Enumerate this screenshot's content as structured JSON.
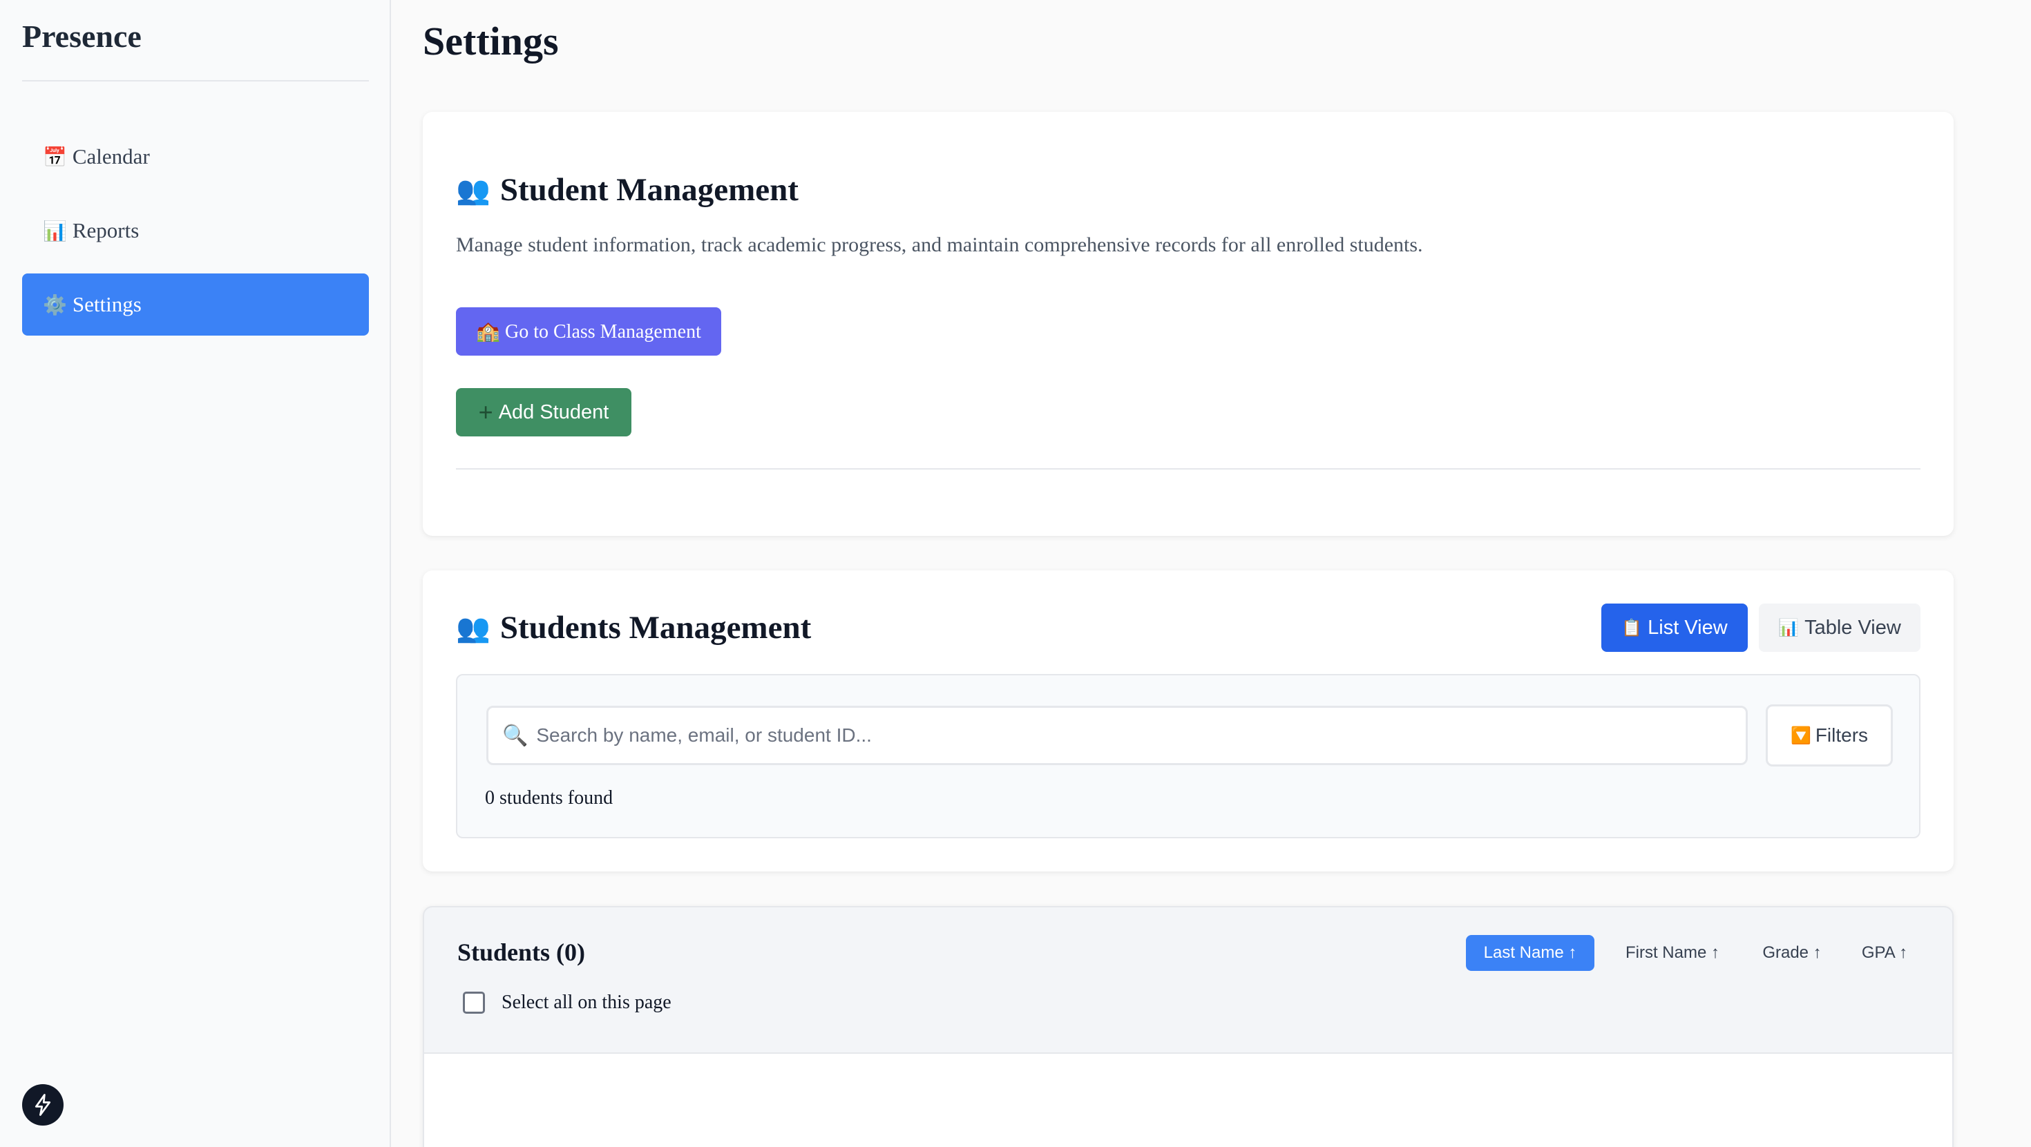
{
  "sidebar": {
    "brand": "Presence",
    "items": [
      {
        "icon": "📅",
        "icon_name": "calendar-icon",
        "label": "Calendar",
        "active": false
      },
      {
        "icon": "📊",
        "icon_name": "bar-chart-icon",
        "label": "Reports",
        "active": false
      },
      {
        "icon": "⚙️",
        "icon_name": "gear-icon",
        "label": "Settings",
        "active": true
      }
    ]
  },
  "page": {
    "title": "Settings"
  },
  "student_management": {
    "icon": "👥",
    "title": "Student Management",
    "description": "Manage student information, track academic progress, and maintain comprehensive records for all enrolled students.",
    "class_button": "🏫 Go to Class Management",
    "add_button_icon": "+",
    "add_button": "Add Student"
  },
  "students_management": {
    "icon": "👥",
    "title": "Students Management",
    "list_view": {
      "icon": "📋",
      "label": "List View",
      "active": true
    },
    "table_view": {
      "icon": "📊",
      "label": "Table View",
      "active": false
    },
    "search": {
      "icon": "🔍",
      "placeholder": "Search by name, email, or student ID...",
      "value": ""
    },
    "filters": {
      "icon": "🔽",
      "label": "Filters"
    },
    "count_text": "0 students found"
  },
  "students_list": {
    "title": "Students (0)",
    "sort_options": [
      {
        "label": "Last Name ↑",
        "active": true
      },
      {
        "label": "First Name ↑",
        "active": false
      },
      {
        "label": "Grade ↑",
        "active": false
      },
      {
        "label": "GPA ↑",
        "active": false
      }
    ],
    "select_all_label": "Select all on this page"
  },
  "colors": {
    "primary": "#3b82f6",
    "purple": "#6366f1",
    "green": "#3f8f63"
  }
}
